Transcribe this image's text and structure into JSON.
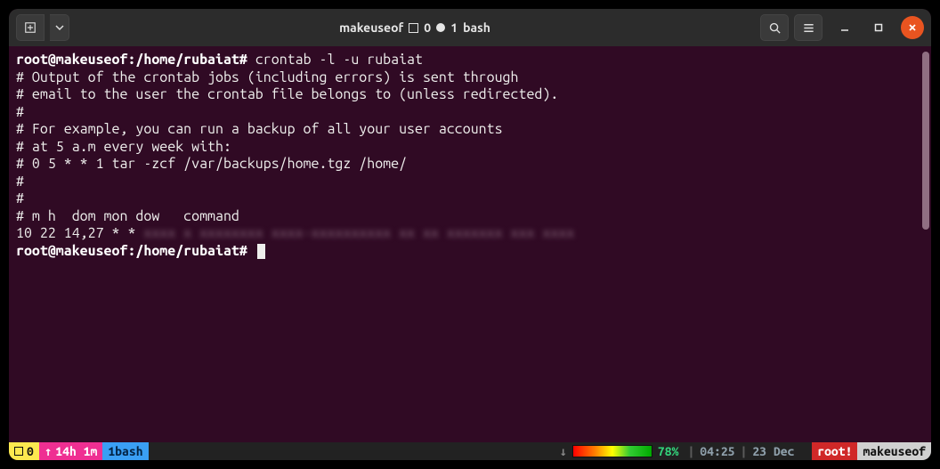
{
  "titlebar": {
    "app": "makeuseof",
    "pane_index": "0",
    "tab_index": "1",
    "shell": "bash"
  },
  "terminal": {
    "prompt1_user": "root@makeuseof",
    "prompt1_path": ":/home/rubaiat#",
    "prompt1_cmd": " crontab -l -u rubaiat",
    "lines": [
      "# Output of the crontab jobs (including errors) is sent through",
      "# email to the user the crontab file belongs to (unless redirected).",
      "#",
      "# For example, you can run a backup of all your user accounts",
      "# at 5 a.m every week with:",
      "# 0 5 * * 1 tar -zcf /var/backups/home.tgz /home/",
      "#",
      "#",
      "# m h  dom mon dow   command",
      "",
      "10 22 14,27 * * "
    ],
    "blurred_cmd": "xxxx x xxxxxxxx xxxx-xxxxxxxxxx xx xx xxxxxxx xxx xxxx",
    "prompt2_user": "root@makeuseof",
    "prompt2_path": ":/home/rubaiat#"
  },
  "status": {
    "left_index": "0",
    "uptime": "14h 1m",
    "tab_number": "1",
    "tab_name": "bash",
    "arrow": "↓",
    "battery_pct": "78%",
    "time": "04:25",
    "date": "23 Dec",
    "user": "root!",
    "host": "makeuseof"
  }
}
